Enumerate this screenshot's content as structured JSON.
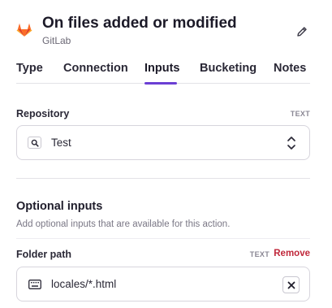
{
  "header": {
    "title": "On files added or modified",
    "subtitle": "GitLab",
    "logo_icon": "gitlab-logo",
    "edit_icon": "pencil-icon"
  },
  "tabs": [
    {
      "label": "Type",
      "active": false
    },
    {
      "label": "Connection",
      "active": false
    },
    {
      "label": "Inputs",
      "active": true
    },
    {
      "label": "Bucketing",
      "active": false
    },
    {
      "label": "Notes",
      "active": false
    }
  ],
  "repository": {
    "label": "Repository",
    "type": "TEXT",
    "value": "Test",
    "icon": "search-icon",
    "control_icon": "chevron-up-down-icon"
  },
  "optional": {
    "title": "Optional inputs",
    "description": "Add optional inputs that are available for this action."
  },
  "folder_path": {
    "label": "Folder path",
    "type": "TEXT",
    "remove_label": "Remove",
    "value": "locales/*.html",
    "icon": "keyboard-icon",
    "clear_icon": "close-icon"
  },
  "colors": {
    "accent": "#6b3fd4",
    "danger": "#c0283b",
    "gitlab_orange": "#e24329"
  }
}
